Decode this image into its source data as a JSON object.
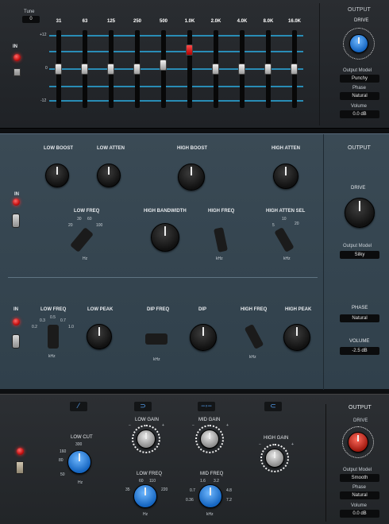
{
  "graphic_eq": {
    "tune_label": "Tune",
    "tune_value": "0",
    "in_label": "IN",
    "scale": [
      "+12",
      "0",
      "-12"
    ],
    "bands": [
      {
        "label": "31",
        "level": 0.5
      },
      {
        "label": "63",
        "level": 0.5
      },
      {
        "label": "125",
        "level": 0.5
      },
      {
        "label": "250",
        "level": 0.5
      },
      {
        "label": "500",
        "level": 0.55
      },
      {
        "label": "1.0K",
        "level": 0.74
      },
      {
        "label": "2.0K",
        "level": 0.5
      },
      {
        "label": "4.0K",
        "level": 0.5
      },
      {
        "label": "8.0K",
        "level": 0.5
      },
      {
        "label": "16.0K",
        "level": 0.5
      }
    ],
    "output": {
      "title": "OUTPUT",
      "drive_label": "DRIVE",
      "model_label": "Output Model",
      "model_value": "Punchy",
      "phase_label": "Phase",
      "phase_value": "Natural",
      "volume_label": "Volume",
      "volume_value": "0.0 dB"
    }
  },
  "pultec": {
    "in_label": "IN",
    "low_boost": "LOW BOOST",
    "low_atten": "LOW ATTEN",
    "high_boost": "HIGH BOOST",
    "high_atten": "HIGH ATTEN",
    "low_freq": "LOW FREQ",
    "low_freq_ticks": [
      "20",
      "30",
      "60",
      "100"
    ],
    "low_freq_unit": "Hz",
    "high_bandwidth": "HIGH BANDWIDTH",
    "high_freq": "HIGH FREQ",
    "high_freq_unit": "kHz",
    "high_atten_sel": "HIGH ATTEN SEL",
    "high_atten_sel_ticks": [
      "5",
      "10",
      "20"
    ],
    "high_atten_sel_unit": "kHz",
    "mid_in_label": "IN",
    "mid_low_freq": "LOW FREQ",
    "mid_low_freq_ticks": [
      "0.2",
      "0.3",
      "0.5",
      "0.7",
      "1.0"
    ],
    "mid_low_freq_unit": "kHz",
    "low_peak": "LOW PEAK",
    "dip_freq": "DIP FREQ",
    "dip_freq_unit": "kHz",
    "dip": "DIP",
    "mid_high_freq": "HIGH FREQ",
    "mid_high_freq_unit": "kHz",
    "high_peak": "HIGH PEAK",
    "output": {
      "title": "OUTPUT",
      "drive_label": "DRIVE",
      "model_label": "Output Model",
      "model_value": "Silky",
      "phase_label": "PHASE",
      "phase_value": "Natural",
      "volume_label": "VOLUME",
      "volume_value": "-2.5 dB"
    }
  },
  "vintage_console": {
    "low_cut_label": "LOW CUT",
    "low_cut_ticks": [
      "50",
      "80",
      "160",
      "300"
    ],
    "low_cut_unit": "Hz",
    "low_gain_label": "LOW GAIN",
    "low_freq_label": "LOW FREQ",
    "low_freq_ticks": [
      "35",
      "60",
      "110",
      "220"
    ],
    "low_freq_unit": "Hz",
    "mid_gain_label": "MID GAIN",
    "mid_freq_label": "MID FREQ",
    "mid_freq_ticks": [
      "0.36",
      "0.7",
      "1.6",
      "3.2",
      "4.8",
      "7.2"
    ],
    "mid_freq_unit": "kHz",
    "high_gain_label": "HIGH GAIN",
    "minus": "−",
    "plus": "+",
    "output": {
      "title": "OUTPUT",
      "drive_label": "DRIVE",
      "model_label": "Output Model",
      "model_value": "Smooth",
      "phase_label": "Phase",
      "phase_value": "Natural",
      "volume_label": "Volume",
      "volume_value": "0.0 dB"
    }
  }
}
